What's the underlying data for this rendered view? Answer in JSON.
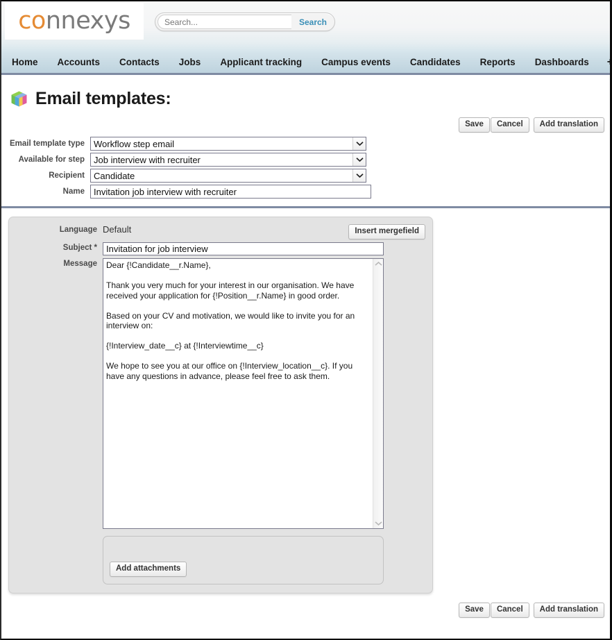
{
  "brand": {
    "logo_text_orange": "co",
    "logo_text_rest": "nnexys",
    "accent_orange": "#e58b34",
    "logo_gray": "#7a7a7a"
  },
  "search": {
    "placeholder": "Search...",
    "value": "",
    "button_label": "Search"
  },
  "nav": {
    "items": [
      {
        "label": "Home"
      },
      {
        "label": "Accounts"
      },
      {
        "label": "Contacts"
      },
      {
        "label": "Jobs"
      },
      {
        "label": "Applicant tracking"
      },
      {
        "label": "Campus events"
      },
      {
        "label": "Candidates"
      },
      {
        "label": "Reports"
      },
      {
        "label": "Dashboards"
      }
    ],
    "add_tab_label": "+"
  },
  "page": {
    "title": "Email templates:",
    "icon": "cube-icon"
  },
  "toolbar": {
    "save_label": "Save",
    "cancel_label": "Cancel",
    "add_translation_label": "Add translation"
  },
  "form": {
    "email_template_type": {
      "label": "Email template type",
      "value": "Workflow step email"
    },
    "available_for_step": {
      "label": "Available for step",
      "value": "Job interview with recruiter"
    },
    "recipient": {
      "label": "Recipient",
      "value": "Candidate"
    },
    "name": {
      "label": "Name",
      "value": "Invitation job interview with recruiter"
    }
  },
  "panel": {
    "language": {
      "label": "Language",
      "value": "Default"
    },
    "insert_mergefield_label": "Insert mergefield",
    "subject": {
      "label": "Subject *",
      "value": "Invitation for job interview"
    },
    "message": {
      "label": "Message",
      "value": "Dear {!Candidate__r.Name},\n\nThank you very much for your interest in our organisation. We have received your application for {!Position__r.Name} in good order.\n\nBased on your CV and motivation, we would like to invite you for an interview on:\n\n{!Interview_date__c} at {!Interviewtime__c}\n\nWe hope to see you at our office on {!Interview_location__c}. If you have any questions in advance, please feel free to ask them."
    },
    "add_attachments_label": "Add attachments"
  },
  "bottom_toolbar": {
    "save_label": "Save",
    "cancel_label": "Cancel",
    "add_translation_label": "Add translation"
  }
}
